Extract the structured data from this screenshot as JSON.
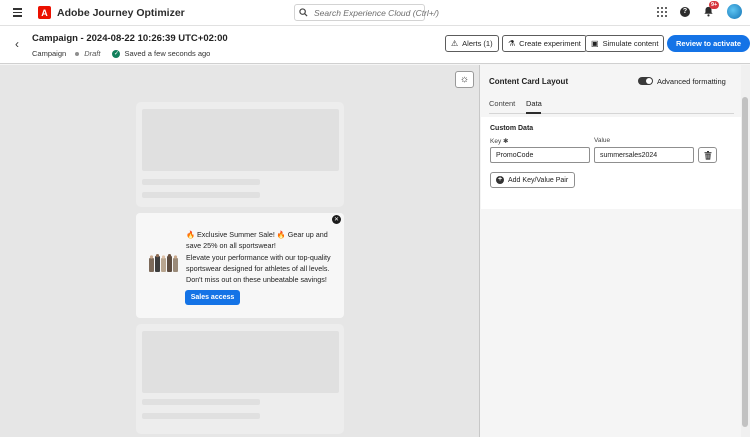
{
  "shell": {
    "app_title": "Adobe Journey Optimizer",
    "logo_letter": "A",
    "search_placeholder": "Search Experience Cloud (Ctrl+/)",
    "notification_badge": "9+",
    "help_glyph": "?"
  },
  "header": {
    "title": "Campaign - 2024-08-22 10:26:39 UTC+02:00",
    "type": "Campaign",
    "status": "Draft",
    "saved": "Saved a few seconds ago",
    "alerts_label": "Alerts (1)",
    "experiment_label": "Create experiment",
    "simulate_label": "Simulate content",
    "review_label": "Review to activate"
  },
  "preview": {
    "promo_head": "🔥 Exclusive Summer Sale! 🔥 Gear up and save 25% on all sportswear!",
    "promo_body": "Elevate your performance with our top-quality sportswear designed for athletes of all levels. Don't miss out on these unbeatable savings!",
    "cta_label": "Sales access",
    "close_glyph": "✕"
  },
  "panel": {
    "title": "Content Card Layout",
    "toggle_label": "Advanced formatting",
    "toggle_on": true,
    "tabs": [
      {
        "label": "Content",
        "active": false
      },
      {
        "label": "Data",
        "active": true
      }
    ],
    "custom_data": {
      "title": "Custom Data",
      "key_label": "Key ✱",
      "value_label": "Value",
      "rows": [
        {
          "key": "PromoCode",
          "value": "summersales2024"
        }
      ],
      "add_label": "Add Key/Value Pair"
    }
  },
  "colors": {
    "accent": "#1473e6",
    "logo_red": "#eb1000",
    "success": "#12805c",
    "badge": "#d7373f"
  },
  "icons": [
    "menu-icon",
    "adobe-logo-icon",
    "search-icon",
    "apps-grid-icon",
    "help-icon",
    "bell-icon",
    "avatar",
    "back-chevron-icon",
    "alert-icon",
    "beaker-icon",
    "simulate-icon",
    "sun-icon",
    "close-icon",
    "trash-icon",
    "add-circle-icon"
  ]
}
